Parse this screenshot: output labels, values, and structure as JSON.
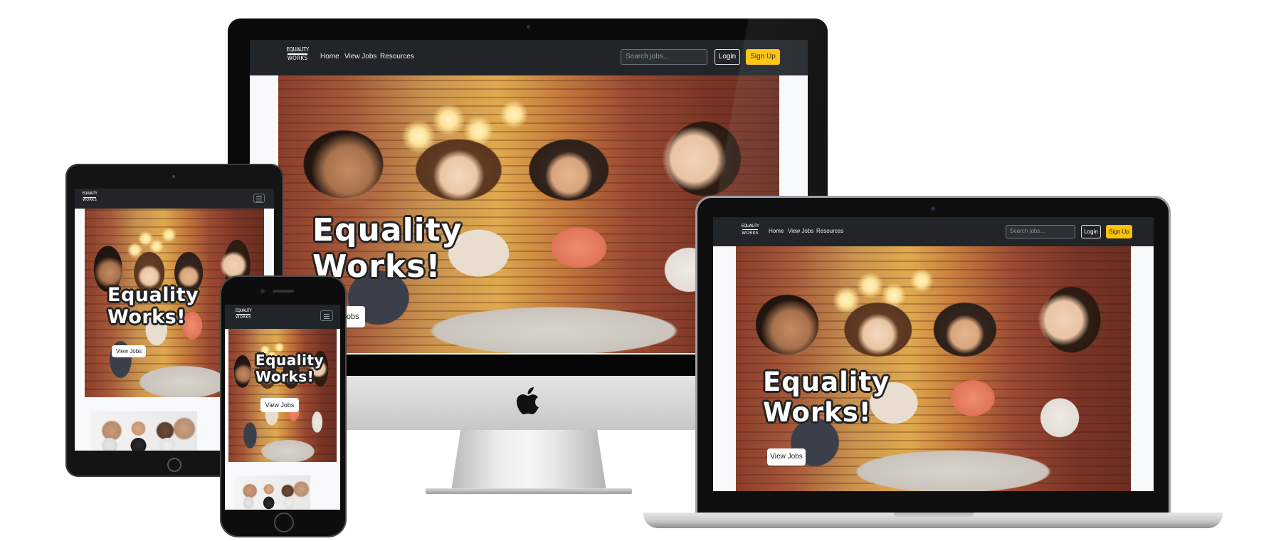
{
  "site": {
    "logo_top": "EQUALITY",
    "logo_bottom": "WORKS",
    "nav_links": [
      "Home",
      "View Jobs",
      "Resources"
    ],
    "search_placeholder": "Search jobs...",
    "login_label": "Login",
    "signup_label": "Sign Up",
    "hero_line1": "Equality",
    "hero_line2": "Works!",
    "hero_button": "View Jobs",
    "imac_hero_button_visible": "Jobs"
  },
  "colors": {
    "navbar": "#212529",
    "accent": "#ffc107",
    "page_bg": "#f8f9fa"
  },
  "icons": {
    "apple": "apple-logo-icon",
    "menu": "hamburger-menu-icon"
  }
}
